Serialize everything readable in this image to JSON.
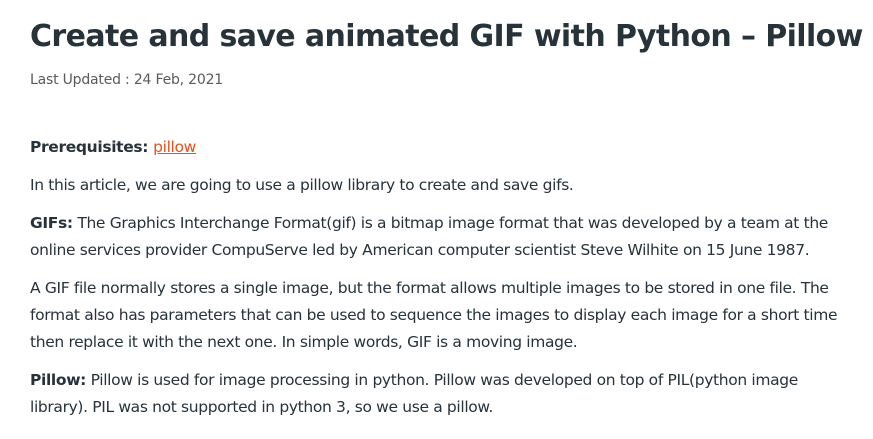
{
  "article": {
    "title": "Create and save animated GIF with Python – Pillow",
    "meta_label": "Last Updated : ",
    "meta_date": "24 Feb, 2021",
    "prerequisites": {
      "label": "Prerequisites: ",
      "link_text": "pillow"
    },
    "intro": "In this article, we are going to use a pillow library to create and save gifs.",
    "gifs": {
      "label": "GIFs:",
      "text": " The Graphics Interchange Format(gif) is a bitmap image format that was developed by a team at the online services provider CompuServe led by American computer scientist Steve Wilhite on 15 June 1987."
    },
    "gif_file_paragraph": "A GIF file normally stores a single image, but the format allows multiple images to be stored in one file. The format also has parameters that can be used to sequence the images to display each image for a short time then replace it with the next one. In simple words, GIF is a moving image.",
    "pillow": {
      "label": "Pillow:",
      "text": " Pillow is used for image processing in python. Pillow was developed on top of PIL(python image library). PIL was not supported in python 3, so we use a pillow."
    }
  }
}
